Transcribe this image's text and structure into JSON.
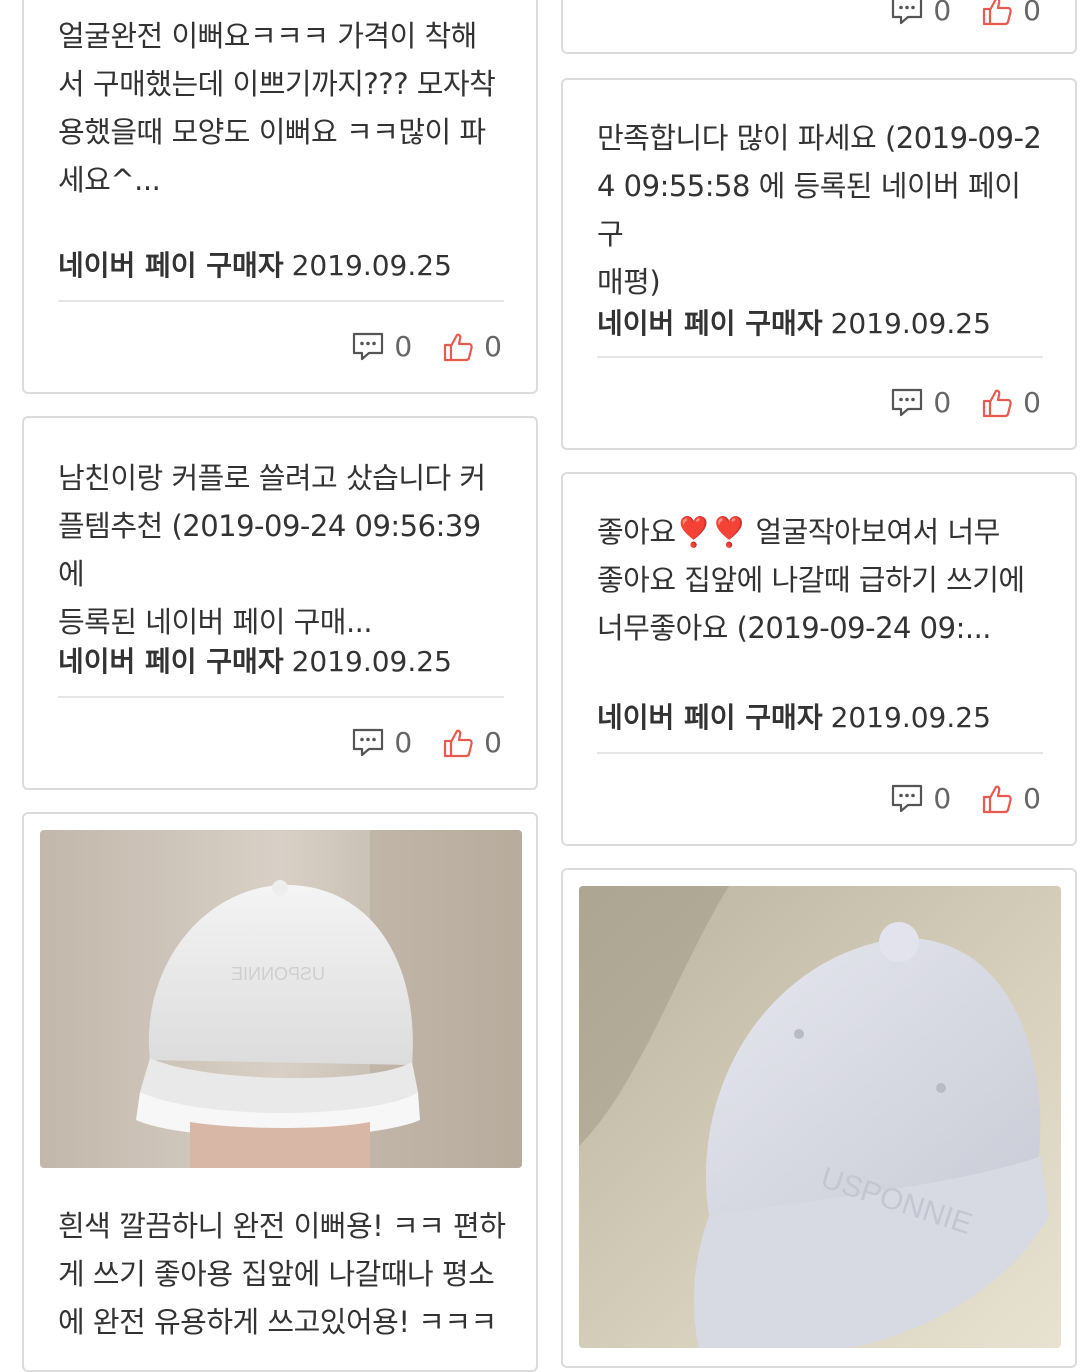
{
  "reviews": [
    {
      "text": "얼굴완전 이뻐요ㅋㅋㅋ 가격이 착해\n서 구매했는데 이쁘기까지??? 모자착\n용했을때 모양도 이뻐요 ㅋㅋ많이 파\n세요^...",
      "author": "네이버 페이 구매자",
      "date": "2019.09.25",
      "comments": "0",
      "likes": "0"
    },
    {
      "comments": "0",
      "likes": "0"
    },
    {
      "text": "만족합니다 많이 파세요 (2019-09-2\n4 09:55:58 에 등록된 네이버 페이 구\n매평)",
      "author": "네이버 페이 구매자",
      "date": "2019.09.25",
      "comments": "0",
      "likes": "0"
    },
    {
      "text": "남친이랑 커플로 쓸려고 샀습니다 커\n플템추천 (2019-09-24 09:56:39 에\n등록된 네이버 페이 구매...",
      "author": "네이버 페이 구매자",
      "date": "2019.09.25",
      "comments": "0",
      "likes": "0"
    },
    {
      "text": "좋아요❣️❣️ 얼굴작아보여서 너무\n좋아요 집앞에 나갈때 급하기 쓰기에\n너무좋아요 (2019-09-24 09:...",
      "author": "네이버 페이 구매자",
      "date": "2019.09.25",
      "comments": "0",
      "likes": "0"
    },
    {
      "text": "흰색 깔끔하니 완전 이뻐용! ㅋㅋ 편하\n게 쓰기 좋아용 집앞에 나갈때나 평소\n에 완전 유용하게 쓰고있어용! ㅋㅋㅋ"
    }
  ],
  "photos": [
    {
      "cap_logo": "USPONNIE"
    },
    {
      "cap_logo": "USPONNIE"
    }
  ],
  "colors": {
    "text": "#333333",
    "border": "#dcdcdc",
    "like_icon": "#e8594f",
    "comment_icon": "#555555"
  },
  "icons": {
    "comment": "speech-bubble-icon",
    "like": "thumbs-up-icon"
  }
}
